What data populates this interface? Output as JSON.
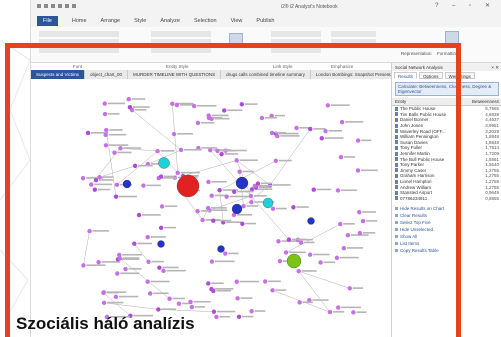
{
  "window": {
    "title": "i2® i2 Analyst's Notebook"
  },
  "menu": [
    "File",
    "Home",
    "Arrange",
    "Style",
    "Analyze",
    "Selection",
    "View",
    "Publish"
  ],
  "ribbon_groups": [
    "Font",
    "Entity Style",
    "Link Style",
    "Emphasize"
  ],
  "ribbon_buttons": {
    "formatting": "Formatting",
    "representation": "Representation"
  },
  "tabs": [
    "Suspects and Victims",
    "object_chart_00",
    "MURDER TIMELINE WITH QUESTIONS",
    "drugs calls combined timeline summary",
    "London Bombings: Snapshot Presentation"
  ],
  "pane": {
    "title": "Social Network Analysis",
    "subtabs": [
      "Results",
      "Options",
      "Weightings"
    ],
    "measure": "Calculate: Betweenness, Closeness, Degree & Eigenvector",
    "col_entity": "Entity",
    "col_value": "Betweenness",
    "rows": [
      {
        "name": "The Public House",
        "value": "6,7565"
      },
      {
        "name": "Tim Balls Public House",
        "value": "4,6839"
      },
      {
        "name": "Daniel Bonner",
        "value": "4,4637"
      },
      {
        "name": "John Jones",
        "value": "3,9951"
      },
      {
        "name": "Waverley Road (OFF...",
        "value": "3,2029"
      },
      {
        "name": "William Pennington",
        "value": "1,8848"
      },
      {
        "name": "Susan Davies",
        "value": "1,8848"
      },
      {
        "name": "Tony Fuller",
        "value": "1,7514"
      },
      {
        "name": "Jennifer Martin",
        "value": "1,7209"
      },
      {
        "name": "The Bull Public House",
        "value": "1,5561"
      },
      {
        "name": "Tony Parker",
        "value": "1,5540"
      },
      {
        "name": "Jimmy Caser",
        "value": "1,2755"
      },
      {
        "name": "Graham Harrison",
        "value": "1,2755"
      },
      {
        "name": "Lionel Hampton",
        "value": "1,2755"
      },
      {
        "name": "Andrew William",
        "value": "1,2755"
      },
      {
        "name": "Stansted Airport",
        "value": "0,9649"
      },
      {
        "name": "07786234911",
        "value": "0,8855"
      }
    ],
    "actions": [
      "Hide Results on Chart",
      "Clear Results",
      "Select Top Five",
      "Hide Unselected",
      "Show All",
      "List Items",
      "Copy Results Table"
    ]
  },
  "caption": "Szociális háló analízis",
  "colors": {
    "frame": "#e6421c",
    "accent": "#2b579a"
  }
}
